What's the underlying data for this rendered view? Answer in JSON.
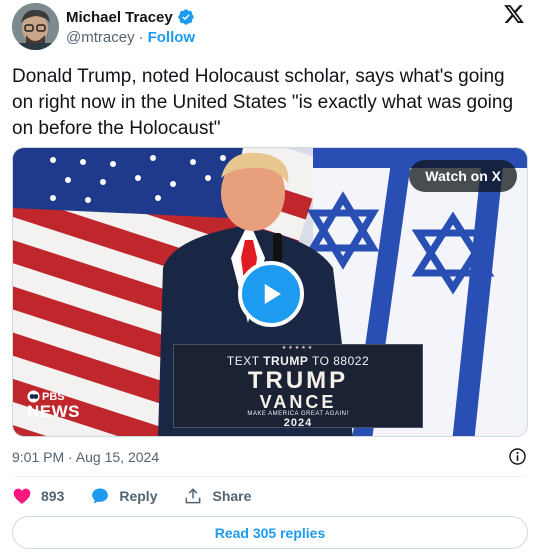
{
  "author": {
    "name": "Michael Tracey",
    "handle": "@mtracey",
    "separator": "·",
    "follow_label": "Follow"
  },
  "tweet": {
    "text": "Donald Trump, noted Holocaust scholar, says what's going on right now in the United States \"is exactly what was going on before the Holocaust\""
  },
  "media": {
    "watch_label": "Watch on X",
    "watermark_top": "PBS",
    "watermark_bottom": "NEWS",
    "podium": {
      "line1_prefix": "TEXT",
      "line1_keyword": "TRUMP",
      "line1_suffix": "TO 88022",
      "line2": "TRUMP",
      "line3": "VANCE",
      "line4": "MAKE AMERICA GREAT AGAIN!",
      "line5": "2024"
    }
  },
  "timestamp": "9:01 PM · Aug 15, 2024",
  "actions": {
    "like_count": "893",
    "reply_label": "Reply",
    "share_label": "Share"
  },
  "read_replies_label": "Read 305 replies",
  "colors": {
    "accent": "#1d9bf0",
    "like": "#f91880",
    "secondary_text": "#536471"
  }
}
